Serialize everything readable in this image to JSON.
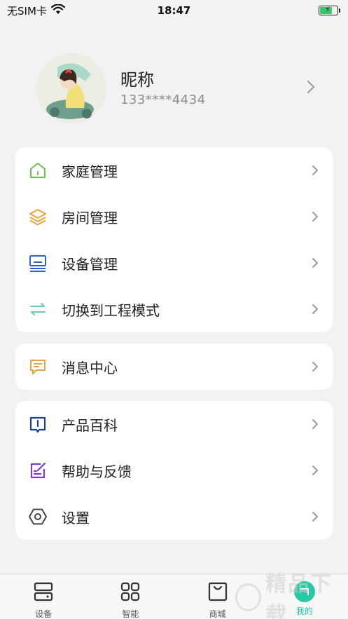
{
  "status": {
    "carrier": "无SIM卡",
    "time": "18:47",
    "battery_level": 0.7
  },
  "profile": {
    "nickname": "昵称",
    "phone": "133****4434"
  },
  "menu_groups": [
    {
      "items": [
        {
          "label": "家庭管理",
          "icon": "home-icon",
          "color": "#6cc24a"
        },
        {
          "label": "房间管理",
          "icon": "layers-icon",
          "color": "#e8a33a"
        },
        {
          "label": "设备管理",
          "icon": "device-icon",
          "color": "#2f5fc8"
        },
        {
          "label": "切换到工程模式",
          "icon": "switch-icon",
          "color": "#5fcfb8"
        }
      ]
    },
    {
      "items": [
        {
          "label": "消息中心",
          "icon": "message-icon",
          "color": "#e8a33a"
        }
      ]
    },
    {
      "items": [
        {
          "label": "产品百科",
          "icon": "book-icon",
          "color": "#1c3f8f"
        },
        {
          "label": "帮助与反馈",
          "icon": "feedback-icon",
          "color": "#7a3bd1"
        },
        {
          "label": "设置",
          "icon": "settings-icon",
          "color": "#444444"
        }
      ]
    }
  ],
  "tabs": [
    {
      "label": "设备",
      "icon": "devices-tab-icon"
    },
    {
      "label": "智能",
      "icon": "grid-tab-icon"
    },
    {
      "label": "商城",
      "icon": "shop-tab-icon"
    },
    {
      "label": "我的",
      "icon": "me-tab-icon",
      "active": true
    }
  ],
  "accent_color": "#29c7a5",
  "watermark": "精品下载"
}
